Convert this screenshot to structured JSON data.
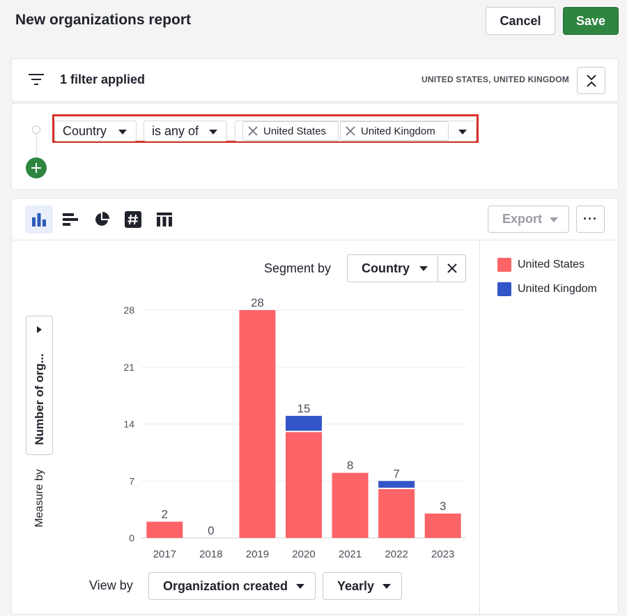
{
  "header": {
    "title": "New organizations report",
    "cancel_label": "Cancel",
    "save_label": "Save"
  },
  "filters": {
    "count_label": "1 filter applied",
    "summary": "UNITED STATES, UNITED KINGDOM",
    "rule": {
      "field": "Country",
      "operator": "is any of",
      "values": [
        "United States",
        "United Kingdom"
      ]
    }
  },
  "toolbar": {
    "chart_types": [
      "column-chart-icon",
      "bar-chart-icon",
      "pie-chart-icon",
      "scorecard-icon",
      "table-icon"
    ],
    "active_chart_type": "column-chart-icon",
    "export_label": "Export",
    "more_label": "···"
  },
  "segment": {
    "label": "Segment by",
    "value": "Country"
  },
  "measure": {
    "label": "Measure by",
    "value": "Number of org..."
  },
  "view_by": {
    "label": "View by",
    "field": "Organization created",
    "interval": "Yearly"
  },
  "colors": {
    "united_states": "#fd6367",
    "united_kingdom": "#3455c7",
    "accent_green": "#2e8540",
    "highlight_red": "#d63228"
  },
  "chart_data": {
    "type": "bar",
    "stacked": true,
    "categories": [
      "2017",
      "2018",
      "2019",
      "2020",
      "2021",
      "2022",
      "2023"
    ],
    "series": [
      {
        "name": "United States",
        "values": [
          2,
          0,
          28,
          13,
          8,
          6,
          3
        ]
      },
      {
        "name": "United Kingdom",
        "values": [
          0,
          0,
          0,
          2,
          0,
          1,
          0
        ]
      }
    ],
    "totals": [
      2,
      0,
      28,
      15,
      8,
      7,
      3
    ],
    "y_ticks": [
      0,
      7,
      14,
      21,
      28
    ],
    "ylim": [
      0,
      28
    ],
    "grid": true,
    "legend_position": "right"
  }
}
